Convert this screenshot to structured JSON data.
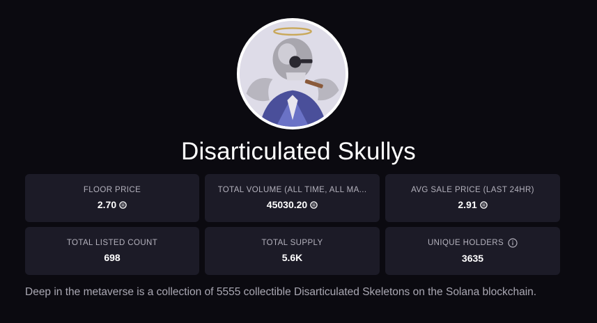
{
  "collection": {
    "name": "Disarticulated Skullys",
    "avatar_icon": "skeleton-avatar-image",
    "description": "Deep in the metaverse is a collection of 5555 collectible Disarticulated Skeletons on the Solana blockchain."
  },
  "stats": [
    {
      "label": "FLOOR PRICE",
      "value": "2.70",
      "currency_icon": "solana-icon"
    },
    {
      "label": "TOTAL VOLUME (ALL TIME, ALL MA...",
      "value": "45030.20",
      "currency_icon": "solana-icon"
    },
    {
      "label": "AVG SALE PRICE (LAST 24HR)",
      "value": "2.91",
      "currency_icon": "solana-icon"
    },
    {
      "label": "TOTAL LISTED COUNT",
      "value": "698"
    },
    {
      "label": "TOTAL SUPPLY",
      "value": "5.6K"
    },
    {
      "label": "UNIQUE HOLDERS",
      "value": "3635",
      "info_icon": "info-icon"
    }
  ],
  "colors": {
    "background": "#0b0a10",
    "card": "#1c1b27",
    "label": "#b4b2bd",
    "value": "#ffffff",
    "description": "#aaa8b3"
  }
}
